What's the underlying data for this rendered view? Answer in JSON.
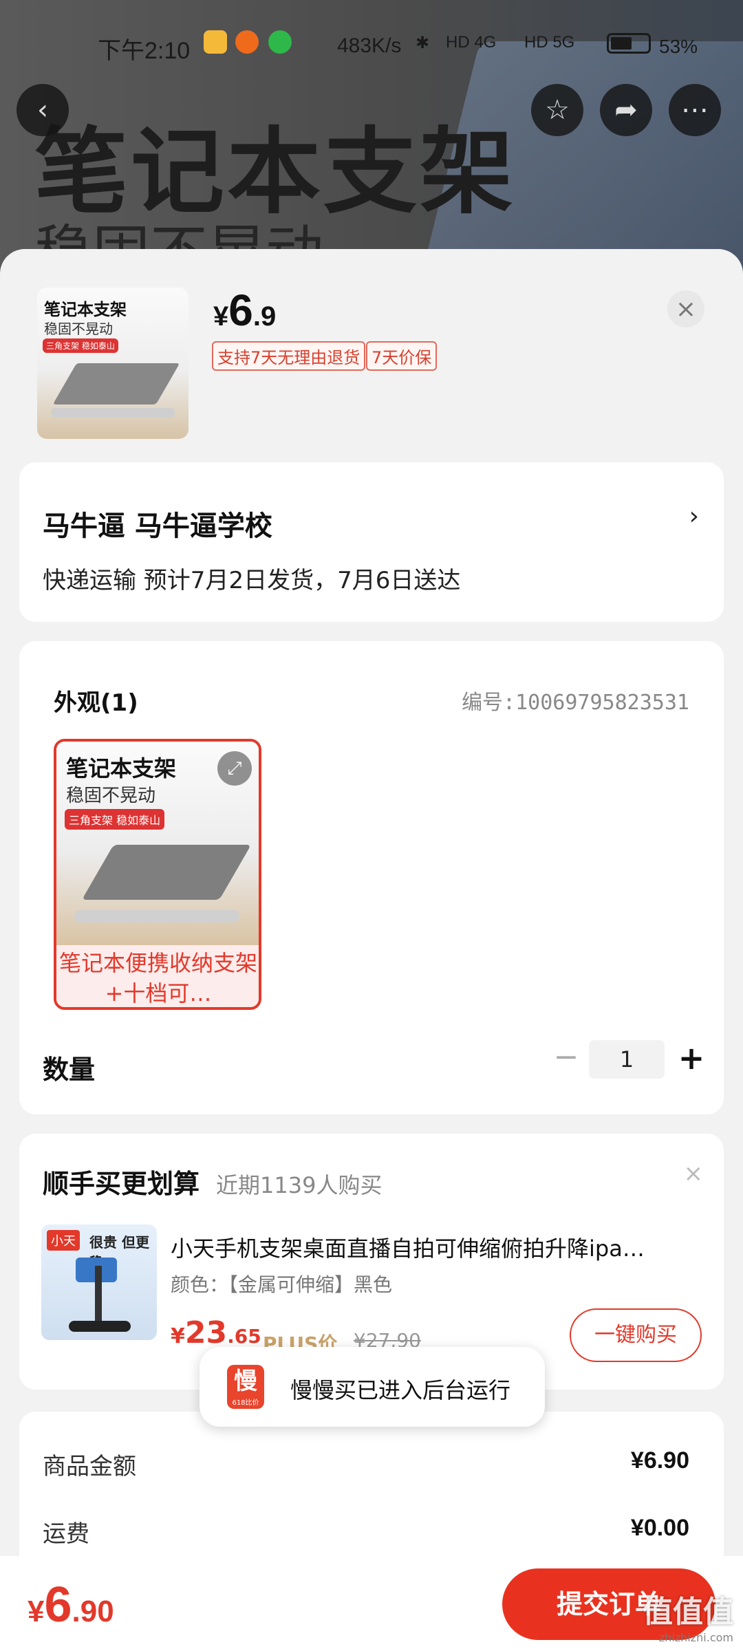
{
  "status_bar": {
    "time": "下午2:10",
    "network_speed": "483K/s",
    "signal_1": "HD 4G",
    "signal_2": "HD 5G",
    "battery_pct": "53%"
  },
  "background": {
    "title": "笔记本支架",
    "subtitle": "稳固不晃动"
  },
  "product": {
    "thumb_title": "笔记本支架",
    "thumb_subtitle": "稳固不晃动",
    "thumb_tag": "三角支架 稳如泰山",
    "price_currency": "¥",
    "price_int": "6",
    "price_dec": ".9",
    "tags": [
      "支持7天无理由退货",
      "7天价保"
    ]
  },
  "address": {
    "name": "马牛逼  马牛逼学校",
    "shipping": "快递运输 预计7月2日发货，7月6日送达"
  },
  "appearance": {
    "title": "外观(1)",
    "sku_id": "编号:10069795823531",
    "variant_title": "笔记本支架",
    "variant_subtitle": "稳固不晃动",
    "variant_tag": "三角支架 稳如泰山",
    "variant_caption": "笔记本便携收纳支架+十档可…"
  },
  "quantity": {
    "label": "数量",
    "minus": "−",
    "value": "1",
    "plus": "+"
  },
  "recommend": {
    "title": "顺手买更划算",
    "subtitle": "近期1139人购买",
    "close": "×",
    "img_badge": "小天",
    "img_text": "很贵 但更稳",
    "name": "小天手机支架桌面直播自拍可伸缩俯拍升降ipa…",
    "color": "颜色：【金属可伸缩】黑色",
    "price_currency": "¥",
    "price_int": "23",
    "price_dec": ".65",
    "plus_label": "PLUS价",
    "orig_price": "¥27.90",
    "buy_label": "一键购买"
  },
  "toast": {
    "logo": "慢",
    "logo_sub": "618比价",
    "text": "慢慢买已进入后台运行"
  },
  "summary": {
    "goods_label": "商品金额",
    "goods_value": "¥6.90",
    "shipping_label": "运费",
    "shipping_value": "¥0.00"
  },
  "bottom": {
    "total_currency": "¥",
    "total_int": "6",
    "total_dec": ".90",
    "submit_label": "提交订单",
    "watermark": "值值值",
    "watermark_url": "zhizhizhi.com"
  },
  "colors": {
    "accent": "#e2392b",
    "submit": "#e8321f"
  }
}
